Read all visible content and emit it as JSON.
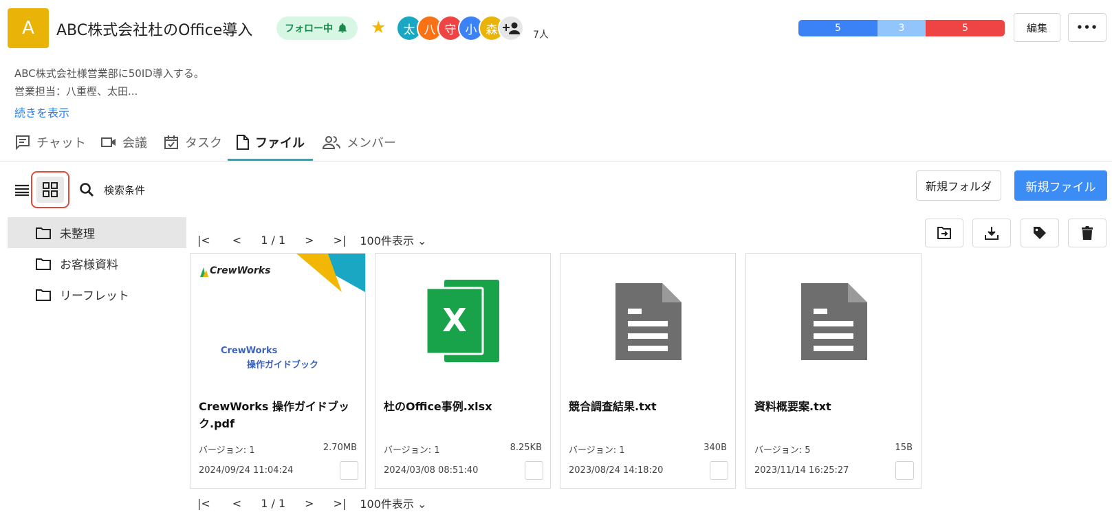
{
  "header": {
    "project_initial": "A",
    "title": "ABC株式会社杜のOffice導入",
    "follow_label": "フォロー中",
    "members": [
      {
        "char": "太",
        "color": "#1aa7c3"
      },
      {
        "char": "八",
        "color": "#f97316"
      },
      {
        "char": "守",
        "color": "#ef4444"
      },
      {
        "char": "小",
        "color": "#3b82f6"
      },
      {
        "char": "森",
        "color": "#eab308"
      }
    ],
    "member_count": "7人",
    "status_counts": [
      {
        "value": "5",
        "color": "#3b82f6"
      },
      {
        "value": "3",
        "color": "#93c5fd"
      },
      {
        "value": "5",
        "color": "#ef4444"
      }
    ],
    "edit_label": "編集",
    "more_label": "•••"
  },
  "description": {
    "line1": "ABC株式会社様営業部に50ID導入する。",
    "line2": "営業担当：八重樫、太田...",
    "show_more": "続きを表示"
  },
  "tabs": [
    {
      "label": "チャット",
      "icon": "chat-icon"
    },
    {
      "label": "会議",
      "icon": "video-icon"
    },
    {
      "label": "タスク",
      "icon": "calendar-check-icon"
    },
    {
      "label": "ファイル",
      "icon": "file-icon",
      "active": true
    },
    {
      "label": "メンバー",
      "icon": "members-icon"
    }
  ],
  "toolbar": {
    "search_label": "検索条件",
    "new_folder": "新規フォルダ",
    "new_file": "新規ファイル"
  },
  "folders": [
    {
      "label": "未整理",
      "selected": true
    },
    {
      "label": "お客様資料"
    },
    {
      "label": "リーフレット"
    }
  ],
  "pagination": {
    "page": "1 / 1",
    "per_page": "100件表示"
  },
  "files": [
    {
      "name": "CrewWorks 操作ガイドブック.pdf",
      "version": "バージョン: 1",
      "size": "2.70MB",
      "date": "2024/09/24 11:04:24",
      "thumb": "pdf",
      "thumb_brand": "CrewWorks",
      "thumb_line1": "CrewWorks",
      "thumb_line2": "操作ガイドブック"
    },
    {
      "name": "杜のOffice事例.xlsx",
      "version": "バージョン: 1",
      "size": "8.25KB",
      "date": "2024/03/08 08:51:40",
      "thumb": "excel"
    },
    {
      "name": "競合調査結果.txt",
      "version": "バージョン: 1",
      "size": "340B",
      "date": "2023/08/24 14:18:20",
      "thumb": "doc"
    },
    {
      "name": "資料概要案.txt",
      "version": "バージョン: 5",
      "size": "15B",
      "date": "2023/11/14 16:25:27",
      "thumb": "doc"
    }
  ]
}
